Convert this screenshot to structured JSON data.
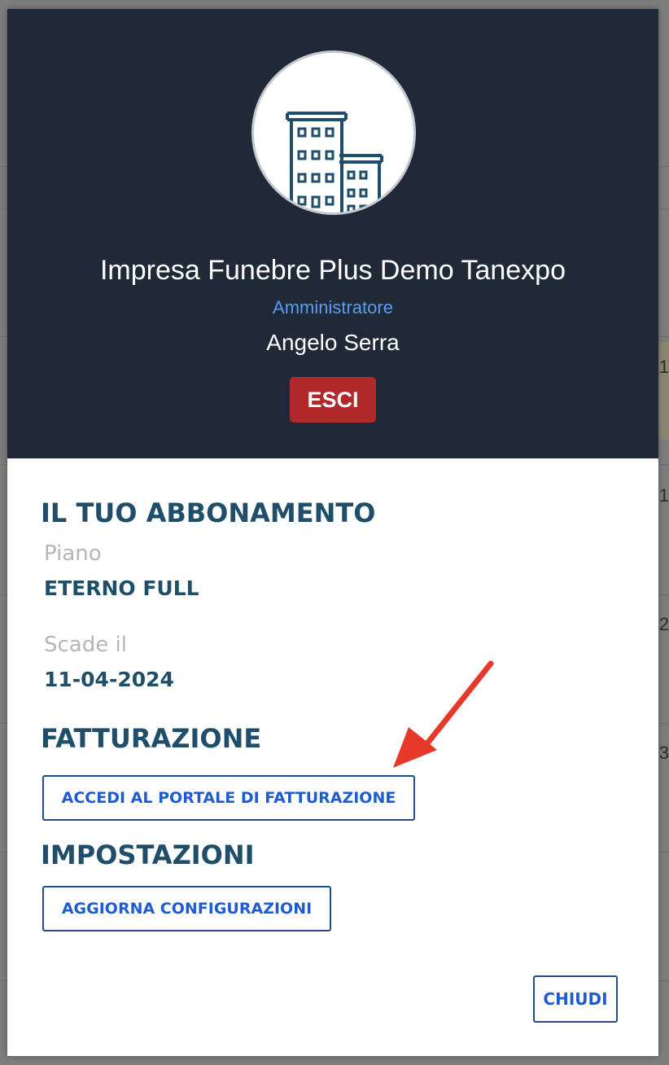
{
  "profile": {
    "company_name": "Impresa Funebre Plus Demo Tanexpo",
    "role": "Amministratore",
    "user_name": "Angelo Serra",
    "logout_label": "ESCI",
    "avatar_icon": "building-icon"
  },
  "subscription": {
    "title": "IL TUO ABBONAMENTO",
    "plan_label": "Piano",
    "plan_value": "ETERNO FULL",
    "expiry_label": "Scade il",
    "expiry_value": "11-04-2024"
  },
  "billing": {
    "title": "FATTURAZIONE",
    "portal_button": "ACCEDI AL PORTALE DI FATTURAZIONE"
  },
  "settings": {
    "title": "IMPOSTAZIONI",
    "update_button": "AGGIORNA CONFIGURAZIONI"
  },
  "footer": {
    "close_button": "CHIUDI"
  },
  "background_hints": [
    "1",
    "1",
    "2",
    "3"
  ],
  "colors": {
    "header_bg": "#1f2937",
    "accent_blue": "#1f5bd1",
    "heading": "#1f4e6b",
    "danger": "#b0282a",
    "annotation_arrow": "#e8382a"
  }
}
